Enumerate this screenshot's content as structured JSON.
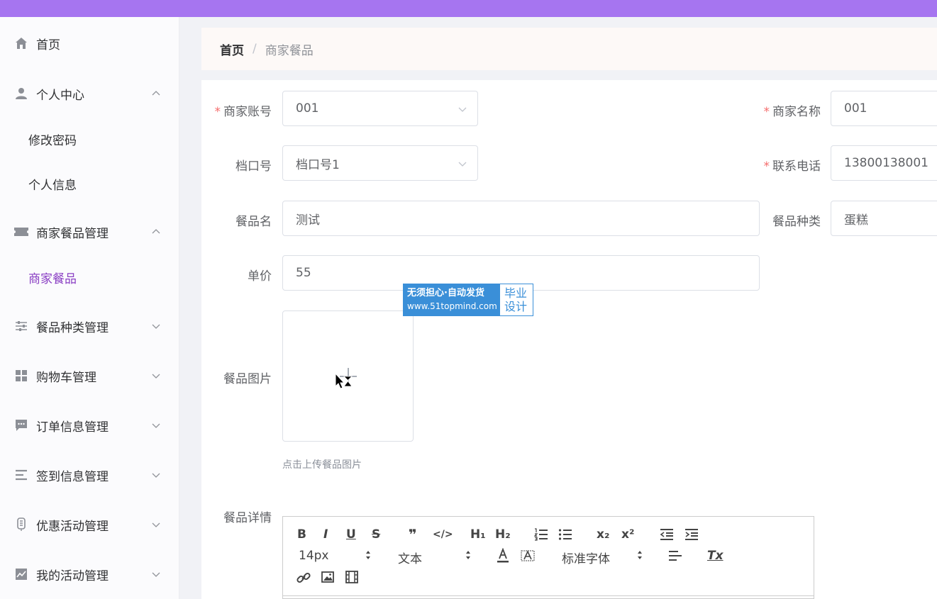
{
  "sidebar": {
    "items": [
      {
        "label": "首页",
        "icon": "home-icon"
      },
      {
        "label": "个人中心",
        "icon": "user-icon",
        "expanded": true,
        "children": [
          "修改密码",
          "个人信息"
        ]
      },
      {
        "label": "商家餐品管理",
        "icon": "ticket-icon",
        "expanded": true,
        "children": [
          "商家餐品"
        ]
      },
      {
        "label": "餐品种类管理",
        "icon": "sliders-icon"
      },
      {
        "label": "购物车管理",
        "icon": "grid-icon"
      },
      {
        "label": "订单信息管理",
        "icon": "chat-icon"
      },
      {
        "label": "签到信息管理",
        "icon": "list-icon"
      },
      {
        "label": "优惠活动管理",
        "icon": "tag-icon"
      },
      {
        "label": "我的活动管理",
        "icon": "chart-icon"
      }
    ],
    "active": "商家餐品",
    "active_color": "#8a3fc4"
  },
  "breadcrumb": {
    "home": "首页",
    "separator": "/",
    "current": "商家餐品"
  },
  "form": {
    "merchant_account": {
      "label": "商家账号",
      "value": "001",
      "required": true
    },
    "merchant_name": {
      "label": "商家名称",
      "value": "001",
      "required": true
    },
    "stall_no": {
      "label": "档口号",
      "value": "档口号1"
    },
    "phone": {
      "label": "联系电话",
      "value": "13800138001",
      "required": true
    },
    "dish_name": {
      "label": "餐品名",
      "value": "测试"
    },
    "dish_type": {
      "label": "餐品种类",
      "value": "蛋糕"
    },
    "price": {
      "label": "单价",
      "value": "55"
    },
    "image": {
      "label": "餐品图片",
      "tip": "点击上传餐品图片"
    },
    "detail": {
      "label": "餐品详情"
    }
  },
  "editor": {
    "bold": "B",
    "italic": "I",
    "underline": "U",
    "strike": "S",
    "quote": "❞",
    "code": "</>",
    "h1": "H₁",
    "h2": "H₂",
    "subscript": "x₂",
    "superscript": "x²",
    "size_select": "14px",
    "header_select": "文本",
    "font_select": "标准字体",
    "clear_format": "Tx"
  },
  "watermark": {
    "line1": "无须担心·自动发货",
    "line2": "www.51topmind.com",
    "right1": "毕业",
    "right2": "设计"
  },
  "colors": {
    "topbar": "#a675f0",
    "required": "#f56c6c",
    "watermark": "#3a8fd8"
  }
}
